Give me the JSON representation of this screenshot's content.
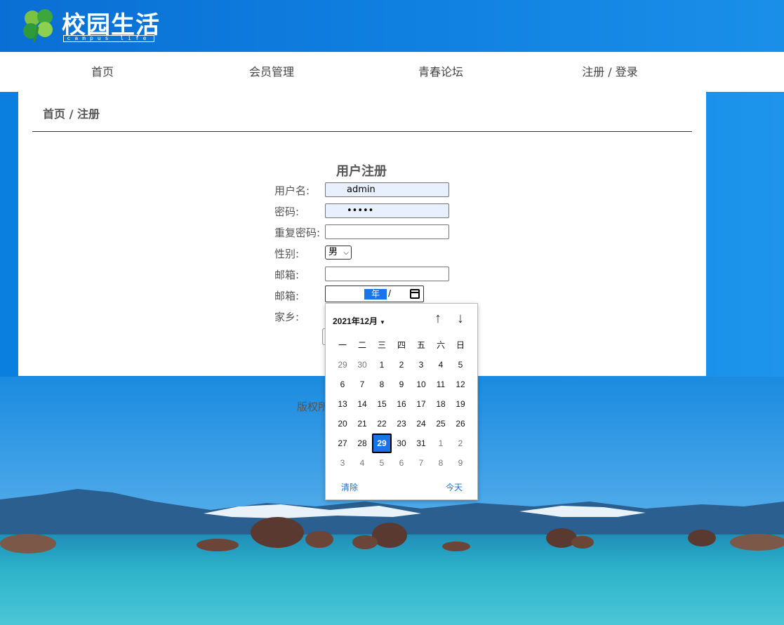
{
  "header": {
    "logo_title": "校园生活",
    "logo_subtitle": "campus life"
  },
  "nav": {
    "items": [
      {
        "label": "首页"
      },
      {
        "label": "会员管理"
      },
      {
        "label": "青春论坛"
      },
      {
        "label": "注册 / 登录"
      }
    ]
  },
  "breadcrumb": "首页 / 注册",
  "form": {
    "title": "用户注册",
    "username_label": "用户名:",
    "username_value": "admin",
    "password_label": "密码:",
    "password_value": "•••••",
    "repeat_label": "重复密码:",
    "repeat_value": "",
    "gender_label": "性别:",
    "gender_value": "男",
    "email_label": "邮箱:",
    "email_value": "",
    "email2_label": "邮箱:",
    "date_year_segment": "年",
    "date_slash": "/",
    "hometown_label": "家乡:"
  },
  "footer": {
    "text": "版权所"
  },
  "calendar": {
    "month_label": "2021年12月",
    "weekdays": [
      "一",
      "二",
      "三",
      "四",
      "五",
      "六",
      "日"
    ],
    "weeks": [
      [
        "29",
        "30",
        "1",
        "2",
        "3",
        "4",
        "5"
      ],
      [
        "6",
        "7",
        "8",
        "9",
        "10",
        "11",
        "12"
      ],
      [
        "13",
        "14",
        "15",
        "16",
        "17",
        "18",
        "19"
      ],
      [
        "20",
        "21",
        "22",
        "23",
        "24",
        "25",
        "26"
      ],
      [
        "27",
        "28",
        "29",
        "30",
        "31",
        "1",
        "2"
      ],
      [
        "3",
        "4",
        "5",
        "6",
        "7",
        "8",
        "9"
      ]
    ],
    "selected": "29",
    "clear_label": "清除",
    "today_label": "今天"
  },
  "colors": {
    "accent": "#1a73e8",
    "header_blue": "#0a6fd4",
    "link": "#1a6fc7"
  },
  "icons": {
    "clover": "clover-logo-icon",
    "calendar": "calendar-icon",
    "up": "arrow-up-icon",
    "down": "arrow-down-icon",
    "caret": "caret-down-icon"
  }
}
